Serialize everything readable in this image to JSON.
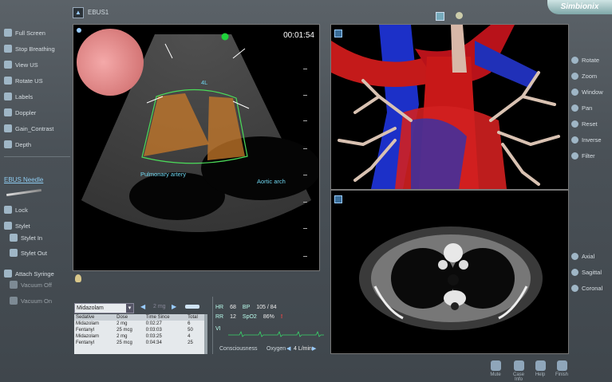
{
  "panel": {
    "title": "EBUS1"
  },
  "brand": {
    "name": "Simbionix"
  },
  "left_tools": [
    {
      "label": "Full Screen",
      "icon": "fullscreen-icon"
    },
    {
      "label": "Stop Breathing",
      "icon": "lungs-icon"
    },
    {
      "label": "View US",
      "icon": "ultrasound-icon"
    },
    {
      "label": "Rotate US",
      "icon": "rotate-icon"
    },
    {
      "label": "Labels",
      "icon": "labels-icon"
    },
    {
      "label": "Doppler",
      "icon": "doppler-icon"
    },
    {
      "label": "Gain_Contrast",
      "icon": "contrast-icon"
    },
    {
      "label": "Depth",
      "icon": "depth-icon"
    }
  ],
  "needle": {
    "title": "EBUS Needle",
    "lock": "Lock",
    "stylet": "Stylet",
    "stylet_in": "Stylet In",
    "stylet_out": "Stylet Out",
    "attach_syringe": "Attach Syringe",
    "vacuum_off": "Vacuum Off",
    "vacuum_on": "Vacuum On"
  },
  "us": {
    "timer": "00:01:54",
    "station": "4L",
    "label_pa": "Pulmonary artery",
    "label_aa": "Aortic arch"
  },
  "right_tools_top": [
    "Rotate",
    "Zoom",
    "Window",
    "Pan",
    "Reset",
    "Inverse",
    "Filter"
  ],
  "right_tools_bottom": [
    "Axial",
    "Sagittal",
    "Coronal"
  ],
  "drug": {
    "selected": "Midazolam",
    "dose_placeholder": "2 mg",
    "columns": [
      "Sedative",
      "Dose",
      "Time Since",
      "Total"
    ],
    "rows": [
      [
        "Midazolam",
        "2 mg",
        "0:02:27",
        "6"
      ],
      [
        "Fentanyl",
        "25 mcg",
        "0:03:03",
        "50"
      ],
      [
        "Midazolam",
        "2 mg",
        "0:03:25",
        "4"
      ],
      [
        "Fentanyl",
        "25 mcg",
        "0:04:34",
        "25"
      ]
    ]
  },
  "vitals": {
    "hr_label": "HR",
    "hr": "68",
    "bp_label": "BP",
    "bp": "105 / 84",
    "rr_label": "RR",
    "rr": "12",
    "spo2_label": "SpO2",
    "spo2": "86%",
    "vi_label": "VI",
    "consciousness": "Consciousness",
    "oxygen_label": "Oxygen",
    "oxygen_value": "4 L/min"
  },
  "bottom_buttons": [
    "Mute",
    "Case Info",
    "Help",
    "Finish"
  ]
}
